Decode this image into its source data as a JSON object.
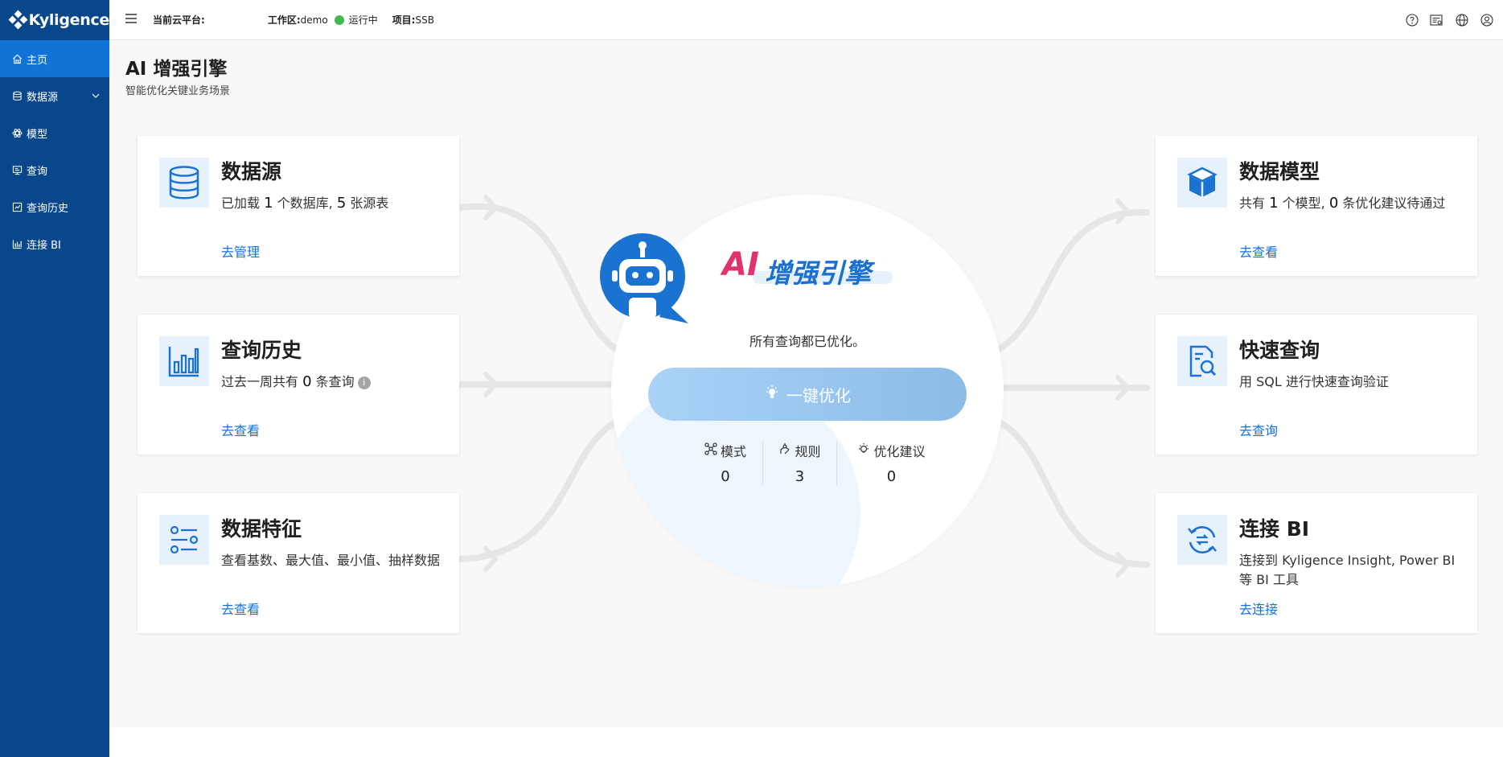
{
  "app": {
    "logo_text": "Kyligence"
  },
  "sidebar": {
    "items": [
      {
        "label": "主页",
        "icon": "home-icon",
        "active": true
      },
      {
        "label": "数据源",
        "icon": "database-icon",
        "has_submenu": true
      },
      {
        "label": "模型",
        "icon": "atom-icon"
      },
      {
        "label": "查询",
        "icon": "monitor-icon"
      },
      {
        "label": "查询历史",
        "icon": "history-icon"
      },
      {
        "label": "连接 BI",
        "icon": "bar-chart-icon"
      }
    ]
  },
  "topbar": {
    "cloud_platform_label": "当前云平台:",
    "workspace_label": "工作区:",
    "workspace_value": "demo",
    "status_text": "运行中",
    "status_color": "#3fb950",
    "project_label": "项目:",
    "project_value": "SSB",
    "right_icons": [
      "help-icon",
      "notes-icon",
      "globe-icon",
      "user-icon"
    ]
  },
  "page": {
    "title": "AI 增强引擎",
    "subtitle": "智能优化关键业务场景"
  },
  "cards": {
    "datasource": {
      "title": "数据源",
      "desc_pre": "已加载 ",
      "db_count": "1",
      "desc_mid": " 个数据库, ",
      "table_count": "5",
      "desc_post": " 张源表",
      "link": "去管理"
    },
    "query_history": {
      "title": "查询历史",
      "desc_pre": "过去一周共有 ",
      "count": "0",
      "desc_post": " 条查询",
      "link": "去查看"
    },
    "data_profile": {
      "title": "数据特征",
      "desc": "查看基数、最大值、最小值、抽样数据",
      "link": "去查看"
    },
    "data_model": {
      "title": "数据模型",
      "desc_pre": "共有 ",
      "model_count": "1",
      "desc_mid": " 个模型, ",
      "suggestion_count": "0",
      "desc_post": " 条优化建议待通过",
      "link": "去查看"
    },
    "quick_query": {
      "title": "快速查询",
      "desc": "用 SQL 进行快速查询验证",
      "link": "去查询"
    },
    "connect_bi": {
      "title": "连接 BI",
      "desc": "连接到 Kyligence Insight, Power BI 等 BI 工具",
      "link": "去连接"
    }
  },
  "center": {
    "ai_text": "AI",
    "engine_text": "增强引擎",
    "status_text": "所有查询都已优化。",
    "button_label": "一键优化",
    "stats": [
      {
        "label": "模式",
        "value": "0",
        "icon": "pattern-icon"
      },
      {
        "label": "规则",
        "value": "3",
        "icon": "rule-icon"
      },
      {
        "label": "优化建议",
        "value": "0",
        "icon": "bulb-icon"
      }
    ]
  },
  "colors": {
    "sidebar_bg": "#08478b",
    "active_nav": "#1173d6",
    "link": "#1173d6",
    "ai_pink": "#e0336e",
    "ai_blue": "#1a6fcf"
  }
}
